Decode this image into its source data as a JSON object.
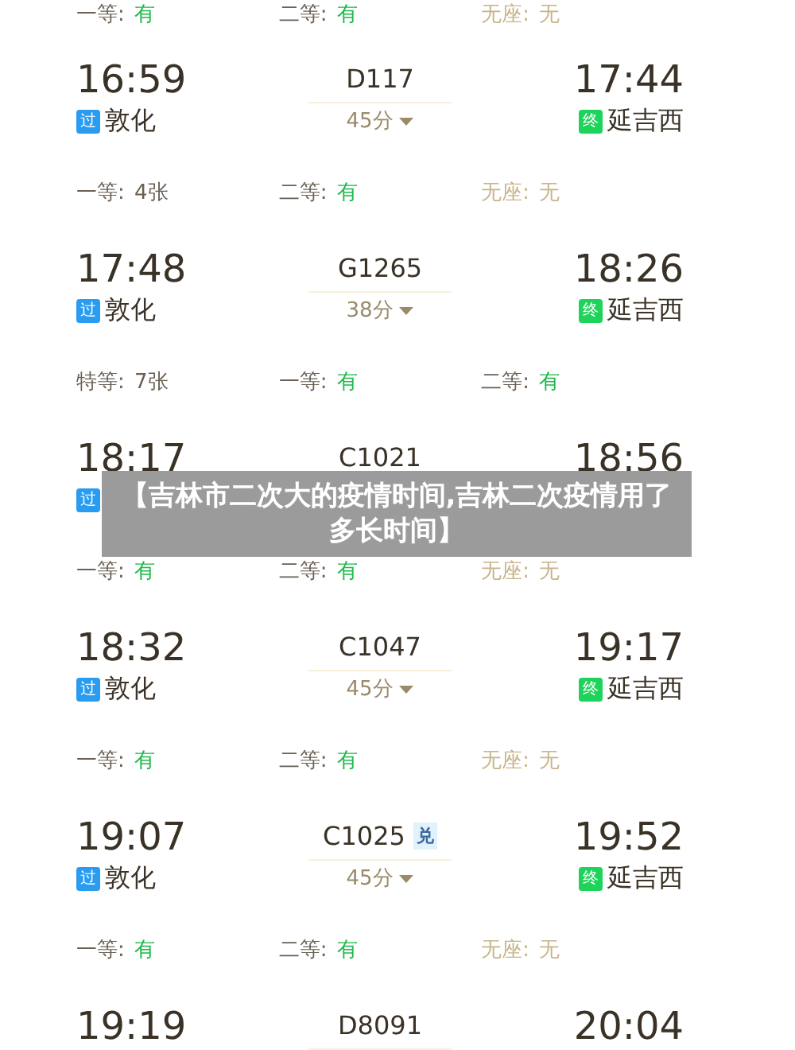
{
  "top_seats": [
    {
      "label": "一等:",
      "value": "有",
      "kind": "plenty"
    },
    {
      "label": "二等:",
      "value": "有",
      "kind": "plenty"
    },
    {
      "label": "无座:",
      "value": "无",
      "kind": "none"
    }
  ],
  "trains": [
    {
      "depart": "16:59",
      "from_badge": "过",
      "from_station": "敦化",
      "train": "D117",
      "duration": "45分",
      "arrive": "17:44",
      "to_badge": "终",
      "to_station": "延吉西",
      "seats": [
        {
          "label": "一等:",
          "value": "4张",
          "kind": "few"
        },
        {
          "label": "二等:",
          "value": "有",
          "kind": "plenty"
        },
        {
          "label": "无座:",
          "value": "无",
          "kind": "none"
        }
      ]
    },
    {
      "depart": "17:48",
      "from_badge": "过",
      "from_station": "敦化",
      "train": "G1265",
      "duration": "38分",
      "arrive": "18:26",
      "to_badge": "终",
      "to_station": "延吉西",
      "seats": [
        {
          "label": "特等:",
          "value": "7张",
          "kind": "few"
        },
        {
          "label": "一等:",
          "value": "有",
          "kind": "plenty"
        },
        {
          "label": "二等:",
          "value": "有",
          "kind": "plenty"
        }
      ]
    },
    {
      "depart": "18:17",
      "from_badge": "过",
      "train": "C1021",
      "arrive": "18:56",
      "seats": [
        {
          "label": "一等:",
          "value": "有",
          "kind": "plenty"
        },
        {
          "label": "二等:",
          "value": "有",
          "kind": "plenty"
        },
        {
          "label": "无座:",
          "value": "无",
          "kind": "none"
        }
      ]
    },
    {
      "depart": "18:32",
      "from_badge": "过",
      "from_station": "敦化",
      "train": "C1047",
      "duration": "45分",
      "arrive": "19:17",
      "to_badge": "终",
      "to_station": "延吉西",
      "seats": [
        {
          "label": "一等:",
          "value": "有",
          "kind": "plenty"
        },
        {
          "label": "二等:",
          "value": "有",
          "kind": "plenty"
        },
        {
          "label": "无座:",
          "value": "无",
          "kind": "none"
        }
      ]
    },
    {
      "depart": "19:07",
      "from_badge": "过",
      "from_station": "敦化",
      "train": "C1025",
      "exchange_badge": "兑",
      "duration": "45分",
      "arrive": "19:52",
      "to_badge": "终",
      "to_station": "延吉西",
      "seats": [
        {
          "label": "一等:",
          "value": "有",
          "kind": "plenty"
        },
        {
          "label": "二等:",
          "value": "有",
          "kind": "plenty"
        },
        {
          "label": "无座:",
          "value": "无",
          "kind": "none"
        }
      ]
    },
    {
      "depart": "19:19",
      "train": "D8091",
      "arrive": "20:04"
    }
  ],
  "overlay": {
    "title": "【吉林市二次大的疫情时间,吉林二次疫情用了多长时间】"
  }
}
